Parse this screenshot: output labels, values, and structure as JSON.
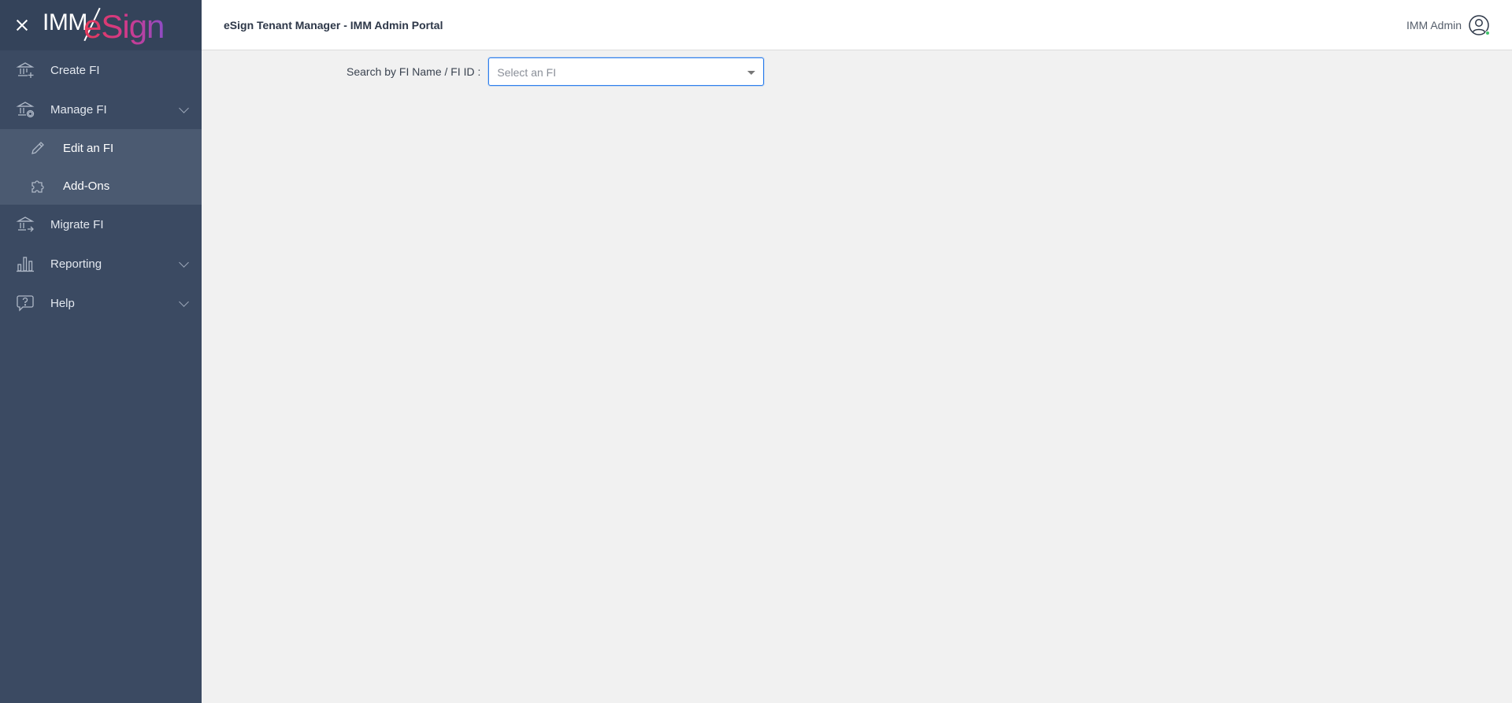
{
  "app": {
    "logo_text_prefix": "IMM",
    "logo_text_brand": "eSign"
  },
  "sidebar": {
    "items": [
      {
        "label": "Create FI",
        "icon": "bank-plus-icon"
      },
      {
        "label": "Manage FI",
        "icon": "bank-gear-icon",
        "expanded": true,
        "children": [
          {
            "label": "Edit an FI",
            "icon": "pencil-icon"
          },
          {
            "label": "Add-Ons",
            "icon": "puzzle-icon"
          }
        ]
      },
      {
        "label": "Migrate FI",
        "icon": "bank-arrow-icon"
      },
      {
        "label": "Reporting",
        "icon": "bar-chart-icon"
      },
      {
        "label": "Help",
        "icon": "help-bubble-icon"
      }
    ]
  },
  "header": {
    "title": "eSign Tenant Manager - IMM Admin Portal",
    "user_name": "IMM Admin"
  },
  "main": {
    "search_label": "Search by FI Name / FI ID :",
    "select_placeholder": "Select an FI"
  },
  "colors": {
    "sidebar_bg": "#3b4a62",
    "submenu_bg": "#4b5a71",
    "accent_blue": "#2f80ed",
    "status_green": "#3fc26a"
  }
}
